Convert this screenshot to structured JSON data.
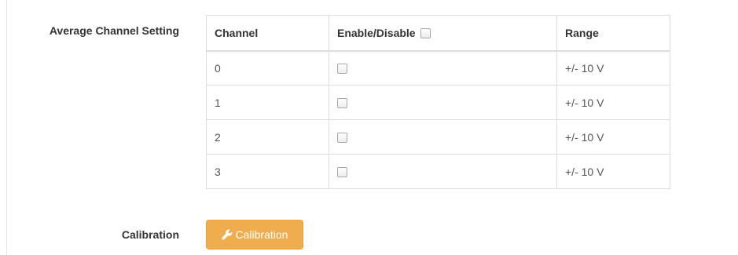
{
  "average_channel_setting": {
    "label": "Average Channel Setting",
    "columns": {
      "channel": "Channel",
      "enable_disable": "Enable/Disable",
      "range": "Range"
    },
    "header_checkbox_checked": false,
    "rows": [
      {
        "channel": "0",
        "enabled": false,
        "range": "+/- 10 V"
      },
      {
        "channel": "1",
        "enabled": false,
        "range": "+/- 10 V"
      },
      {
        "channel": "2",
        "enabled": false,
        "range": "+/- 10 V"
      },
      {
        "channel": "3",
        "enabled": false,
        "range": "+/- 10 V"
      }
    ]
  },
  "calibration": {
    "label": "Calibration",
    "button_label": "Calibration",
    "button_icon": "wrench-icon",
    "button_color": "#f0ad4e"
  }
}
